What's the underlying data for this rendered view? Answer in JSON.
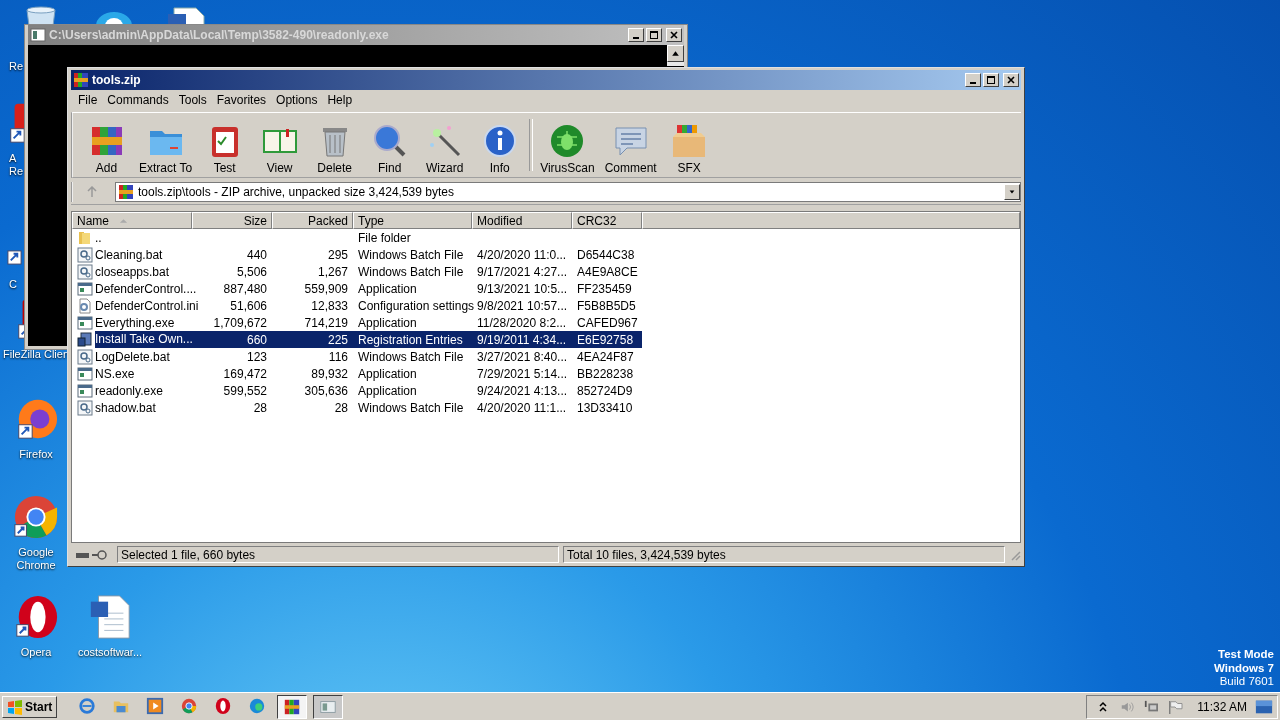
{
  "desktop": {
    "icons": [
      {
        "kind": "recycle-bin",
        "lines": [
          "Re"
        ]
      },
      {
        "kind": "skype"
      },
      {
        "kind": "document"
      },
      {
        "kind": "acrobat",
        "lines": [
          "A",
          "Re"
        ]
      },
      {
        "kind": "generic",
        "lines": [
          "C"
        ]
      },
      {
        "kind": "filezilla",
        "lines": [
          "FileZilla Clien"
        ]
      },
      {
        "kind": "firefox",
        "lines": [
          "Firefox"
        ]
      },
      {
        "kind": "chrome",
        "lines": [
          "Google",
          "Chrome"
        ]
      },
      {
        "kind": "opera",
        "lines": [
          "Opera"
        ]
      },
      {
        "kind": "word",
        "lines": [
          "costsoftwar..."
        ]
      }
    ],
    "edition": [
      "Test Mode",
      "Windows 7",
      "Build 7601"
    ]
  },
  "console_window": {
    "title": "C:\\Users\\admin\\AppData\\Local\\Temp\\3582-490\\readonly.exe"
  },
  "archive_window": {
    "title": "tools.zip",
    "menu": [
      "File",
      "Commands",
      "Tools",
      "Favorites",
      "Options",
      "Help"
    ],
    "toolbar": [
      {
        "kind": "add",
        "label": "Add"
      },
      {
        "kind": "extract",
        "label": "Extract To"
      },
      {
        "kind": "test",
        "label": "Test"
      },
      {
        "kind": "view",
        "label": "View"
      },
      {
        "kind": "delete",
        "label": "Delete"
      },
      {
        "kind": "find",
        "label": "Find"
      },
      {
        "kind": "wizard",
        "label": "Wizard"
      },
      {
        "kind": "info",
        "label": "Info"
      },
      {
        "kind": "virusscan",
        "label": "VirusScan"
      },
      {
        "kind": "comment",
        "label": "Comment"
      },
      {
        "kind": "sfx",
        "label": "SFX"
      }
    ],
    "path": "tools.zip\\tools - ZIP archive, unpacked size 3,424,539 bytes",
    "columns": [
      {
        "label": "Name",
        "sorted": true
      },
      {
        "label": "Size",
        "sorted": false
      },
      {
        "label": "Packed",
        "sorted": false
      },
      {
        "label": "Type",
        "sorted": false
      },
      {
        "label": "Modified",
        "sorted": false
      },
      {
        "label": "CRC32",
        "sorted": false
      }
    ],
    "rows": [
      {
        "kind": "folder",
        "selected": false,
        "cells": [
          "..",
          "",
          "",
          "File folder",
          "",
          ""
        ]
      },
      {
        "kind": "batch",
        "selected": false,
        "cells": [
          "Cleaning.bat",
          "440",
          "295",
          "Windows Batch File",
          "4/20/2020 11:0...",
          "D6544C38"
        ]
      },
      {
        "kind": "batch",
        "selected": false,
        "cells": [
          "closeapps.bat",
          "5,506",
          "1,267",
          "Windows Batch File",
          "9/17/2021 4:27...",
          "A4E9A8CE"
        ]
      },
      {
        "kind": "app",
        "selected": false,
        "cells": [
          "DefenderControl....",
          "887,480",
          "559,909",
          "Application",
          "9/13/2021 10:5...",
          "FF235459"
        ]
      },
      {
        "kind": "settings",
        "selected": false,
        "cells": [
          "DefenderControl.ini",
          "51,606",
          "12,833",
          "Configuration settings",
          "9/8/2021 10:57...",
          "F5B8B5D5"
        ]
      },
      {
        "kind": "app",
        "selected": false,
        "cells": [
          "Everything.exe",
          "1,709,672",
          "714,219",
          "Application",
          "11/28/2020 8:2...",
          "CAFED967"
        ]
      },
      {
        "kind": "registry",
        "selected": true,
        "cells": [
          "Install Take Own...",
          "660",
          "225",
          "Registration Entries",
          "9/19/2011 4:34...",
          "E6E92758"
        ]
      },
      {
        "kind": "batch",
        "selected": false,
        "cells": [
          "LogDelete.bat",
          "123",
          "116",
          "Windows Batch File",
          "3/27/2021 8:40...",
          "4EA24F87"
        ]
      },
      {
        "kind": "app",
        "selected": false,
        "cells": [
          "NS.exe",
          "169,472",
          "89,932",
          "Application",
          "7/29/2021 5:14...",
          "BB228238"
        ]
      },
      {
        "kind": "app",
        "selected": false,
        "cells": [
          "readonly.exe",
          "599,552",
          "305,636",
          "Application",
          "9/24/2021 4:13...",
          "852724D9"
        ]
      },
      {
        "kind": "batch",
        "selected": false,
        "cells": [
          "shadow.bat",
          "28",
          "28",
          "Windows Batch File",
          "4/20/2020 11:1...",
          "13D33410"
        ]
      }
    ],
    "status_left": "Selected 1 file, 660 bytes",
    "status_right": "Total 10 files, 3,424,539 bytes"
  },
  "taskbar": {
    "start": "Start",
    "apps": [
      {
        "kind": "ie",
        "open": false,
        "selected": false
      },
      {
        "kind": "explorer",
        "open": false,
        "selected": false
      },
      {
        "kind": "media",
        "open": false,
        "selected": false
      },
      {
        "kind": "chrome",
        "open": false,
        "selected": false
      },
      {
        "kind": "opera",
        "open": false,
        "selected": false
      },
      {
        "kind": "edge",
        "open": false,
        "selected": false
      },
      {
        "kind": "winrar",
        "open": true,
        "selected": true
      },
      {
        "kind": "console",
        "open": true,
        "selected": false
      }
    ],
    "clock": "11:32 AM"
  }
}
